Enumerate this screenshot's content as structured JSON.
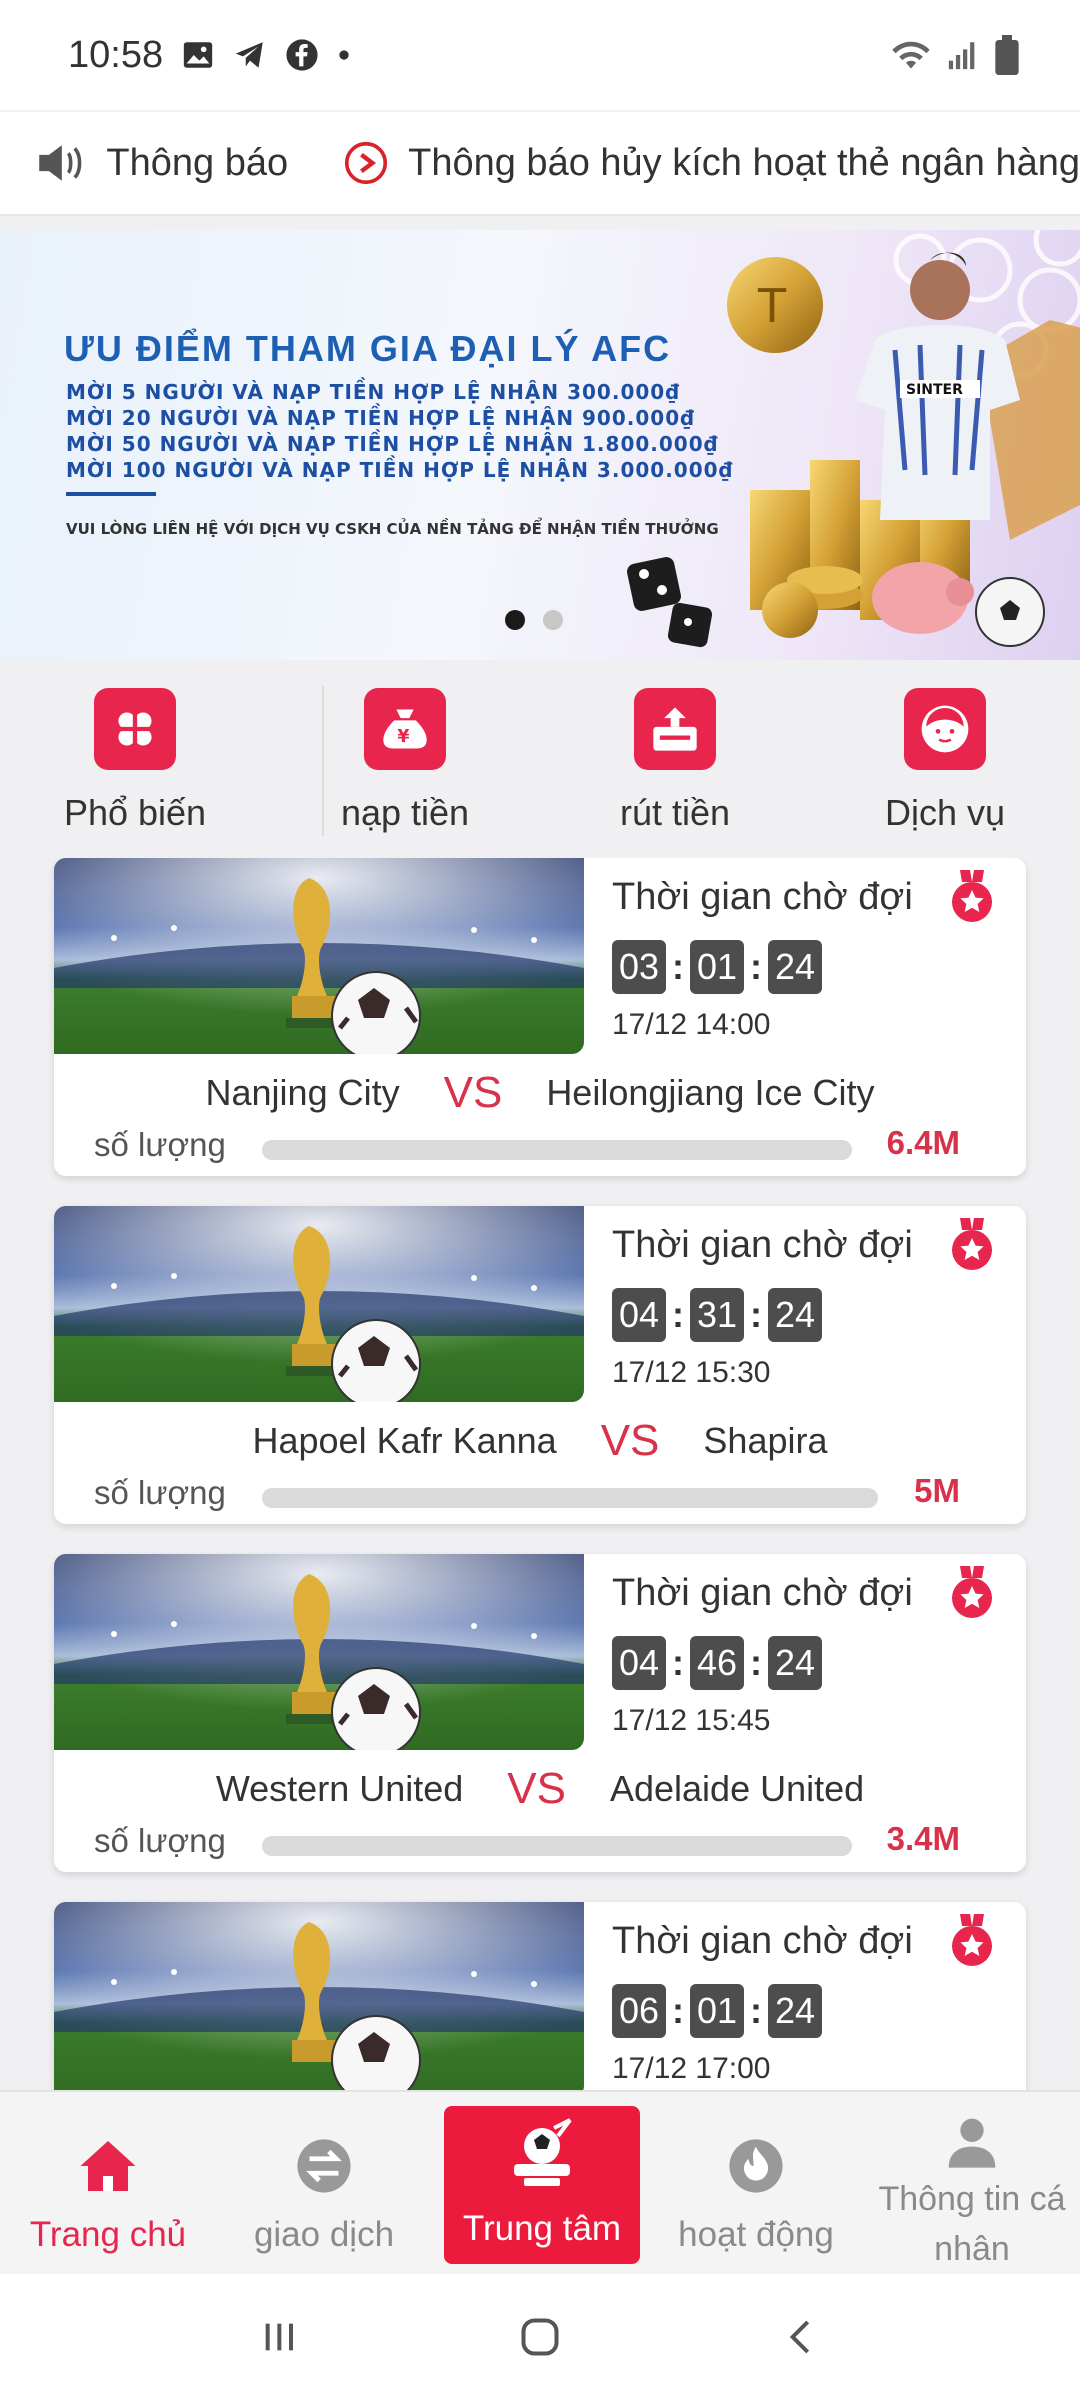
{
  "status_bar": {
    "time": "10:58",
    "left_icons": [
      "image-icon",
      "telegram-icon",
      "facebook-icon",
      "dot-icon"
    ],
    "right_icons": [
      "wifi-icon",
      "signal-icon",
      "battery-icon"
    ]
  },
  "notice": {
    "label": "Thông báo",
    "message": "Thông báo hủy kích hoạt thẻ ngân hàng"
  },
  "banner": {
    "title": "ƯU ĐIỂM  THAM GIA ĐẠI LÝ AFC",
    "lines": [
      "MỜI 5 NGƯỜI VÀ NẠP TIỀN HỢP LỆ NHẬN 300.000₫",
      "MỜI 20 NGƯỜI VÀ NẠP TIỀN HỢP LỆ NHẬN 900.000₫",
      "MỜI 50 NGƯỜI VÀ NẠP TIỀN HỢP LỆ NHẬN 1.800.000₫",
      "MỜI 100 NGƯỜI VÀ NẠP TIỀN HỢP LỆ NHẬN 3.000.000₫"
    ],
    "footer": "VUI LÒNG LIÊN HỆ VỚI DỊCH VỤ CSKH CỦA NỀN TẢNG ĐỂ NHẬN TIỀN THƯỞNG",
    "jersey_text": "SINTER",
    "slides_total": 2,
    "slide_active": 1
  },
  "quick_nav": [
    {
      "label": "Phổ biến",
      "icon": "grid-icon"
    },
    {
      "label": "nạp tiền",
      "icon": "money-bag-icon"
    },
    {
      "label": "rút tiền",
      "icon": "withdraw-icon"
    },
    {
      "label": "Dịch vụ",
      "icon": "support-agent-icon"
    }
  ],
  "matches": [
    {
      "wait_label": "Thời gian chờ đợi",
      "timer": [
        "03",
        "01",
        "24"
      ],
      "date": "17/12 14:00",
      "home": "Nanjing City",
      "vs": "VS",
      "away": "Heilongjiang Ice City",
      "qty_label": "số lượng",
      "amount": "6.4M"
    },
    {
      "wait_label": "Thời gian chờ đợi",
      "timer": [
        "04",
        "31",
        "24"
      ],
      "date": "17/12 15:30",
      "home": "Hapoel Kafr Kanna",
      "vs": "VS",
      "away": "Shapira",
      "qty_label": "số lượng",
      "amount": "5M"
    },
    {
      "wait_label": "Thời gian chờ đợi",
      "timer": [
        "04",
        "46",
        "24"
      ],
      "date": "17/12 15:45",
      "home": "Western United",
      "vs": "VS",
      "away": "Adelaide United",
      "qty_label": "số lượng",
      "amount": "3.4M"
    },
    {
      "wait_label": "Thời gian chờ đợi",
      "timer": [
        "06",
        "01",
        "24"
      ],
      "date": "17/12 17:00",
      "home": "",
      "vs": "",
      "away": "",
      "qty_label": "",
      "amount": ""
    }
  ],
  "bottom_nav": [
    {
      "label": "Trang chủ",
      "icon": "home-icon",
      "active": true
    },
    {
      "label": "giao dịch",
      "icon": "exchange-icon",
      "active": false
    },
    {
      "label": "Trung tâm",
      "icon": "football-afc-logo",
      "active": false
    },
    {
      "label": "hoạt động",
      "icon": "flame-icon",
      "active": false
    },
    {
      "label": "Thông tin cá nhân",
      "icon": "user-icon",
      "active": false
    }
  ],
  "colors": {
    "accent": "#e8254d",
    "center_tab": "#ec1b3e",
    "vs": "#d8324a",
    "timer_box": "#4d4d4d",
    "banner_text": "#1c4fa3"
  }
}
